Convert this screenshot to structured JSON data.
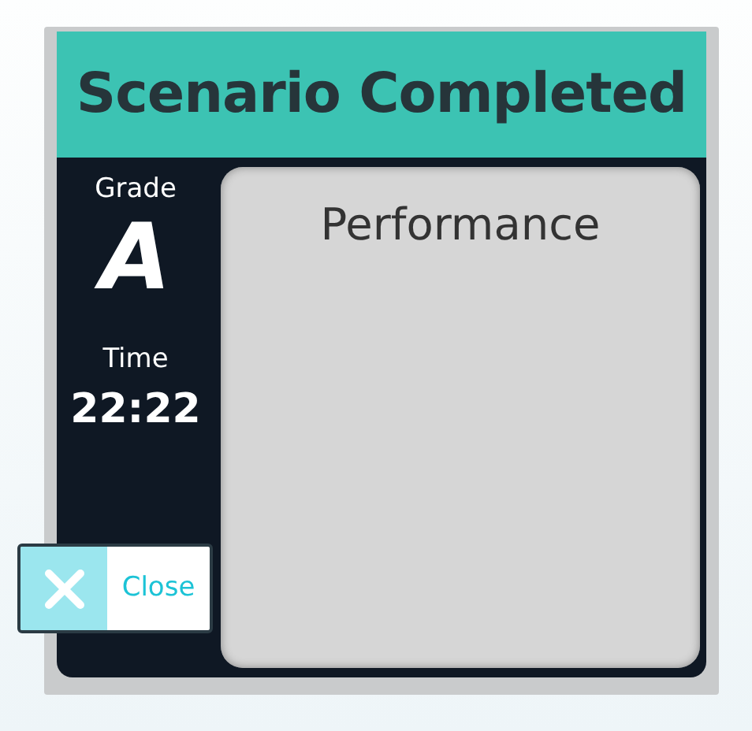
{
  "title": "Scenario Completed",
  "grade": {
    "label": "Grade",
    "value": "A"
  },
  "time": {
    "label": "Time",
    "value": "22:22"
  },
  "performance": {
    "title": "Performance"
  },
  "close_button": {
    "label": "Close"
  }
}
